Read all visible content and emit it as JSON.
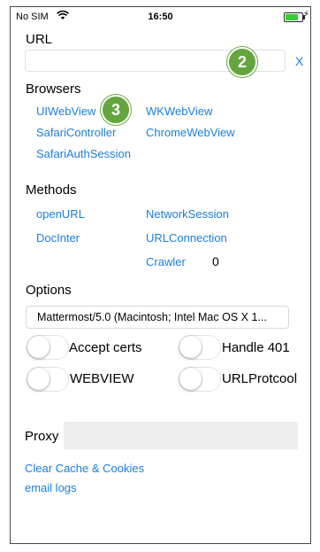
{
  "status_bar": {
    "carrier": "No SIM",
    "time": "16:50",
    "charging": "⚡"
  },
  "url_section": {
    "label": "URL",
    "input_value": "",
    "clear_label": "X"
  },
  "badges": {
    "first": "2",
    "second": "3"
  },
  "browsers": {
    "label": "Browsers",
    "items": [
      "UIWebView",
      "WKWebView",
      "SafariController",
      "ChromeWebView",
      "SafariAuthSession"
    ]
  },
  "methods": {
    "label": "Methods",
    "items": [
      "openURL",
      "NetworkSession",
      "DocInter",
      "URLConnection",
      "Crawler"
    ],
    "crawler_count": "0"
  },
  "options": {
    "label": "Options",
    "user_agent": "Mattermost/5.0 (Macintosh; Intel Mac OS X 1...",
    "toggles": [
      {
        "label": "Accept certs",
        "on": false
      },
      {
        "label": "Handle 401",
        "on": false
      },
      {
        "label": "WEBVIEW",
        "on": false
      },
      {
        "label": "URLProtcool",
        "on": false
      }
    ]
  },
  "proxy": {
    "label": "Proxy",
    "value": ""
  },
  "footer_links": {
    "clear_cache": "Clear Cache & Cookies",
    "email_logs": "email logs"
  },
  "colors": {
    "link": "#1a7ee6",
    "badge": "#64a63e",
    "battery": "#33cc33"
  }
}
